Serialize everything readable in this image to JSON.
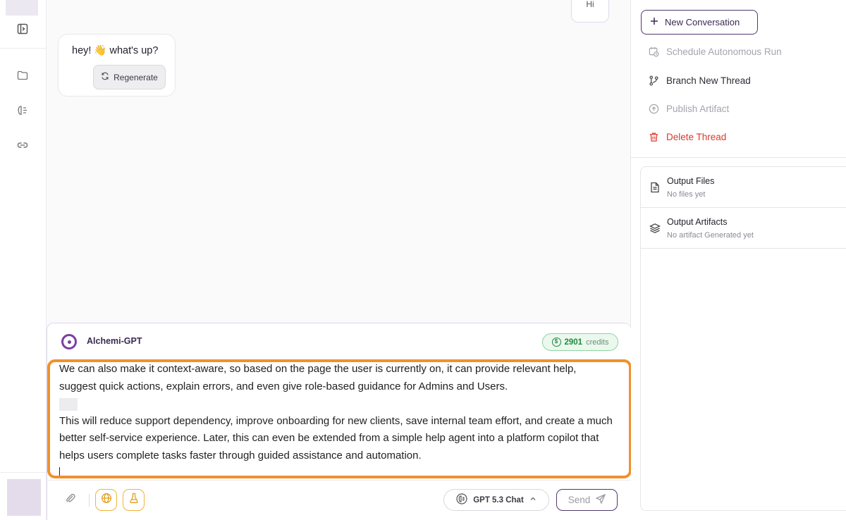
{
  "chat": {
    "user_bubble_stub": "Hi",
    "ai_message": "hey! 👋 what's up?",
    "regenerate_label": "Regenerate"
  },
  "composer": {
    "agent_name": "Alchemi-GPT",
    "credits_value": "2901",
    "credits_label": "credits",
    "paragraph1": "We can also make it context-aware, so based on the page the user is currently on, it can provide relevant help, suggest quick actions, explain errors, and even give role-based guidance for Admins and Users.",
    "paragraph2": "This will reduce support dependency, improve onboarding for new clients, save internal team effort, and create a much better self-service experience. Later, this can even be extended from a simple help agent into a platform copilot that helps users complete tasks faster through guided assistance and automation.",
    "model_label": "GPT 5.3 Chat",
    "send_label": "Send"
  },
  "panel": {
    "new_conversation": "New Conversation",
    "menu": [
      {
        "label": "Schedule Autonomous Run",
        "state": "disabled"
      },
      {
        "label": "Branch New Thread",
        "state": "normal"
      },
      {
        "label": "Publish Artifact",
        "state": "disabled"
      },
      {
        "label": "Delete Thread",
        "state": "danger"
      }
    ],
    "outputs": [
      {
        "title": "Output Files",
        "subtitle": "No files yet"
      },
      {
        "title": "Output Artifacts",
        "subtitle": "No artifact Generated yet"
      }
    ]
  },
  "colors": {
    "accent": "#4e3a6e",
    "editor_focus_border": "#f0912d",
    "credits_green": "#1e8a3c",
    "danger": "#d93a2c"
  }
}
